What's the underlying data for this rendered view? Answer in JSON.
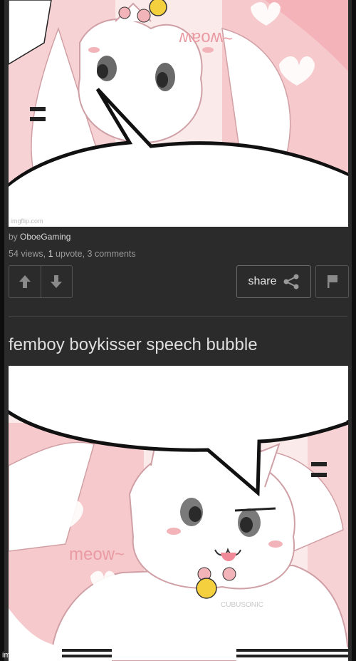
{
  "post1": {
    "image_watermark": "imgflip.com",
    "meow_text": "~woaw",
    "by_prefix": "by",
    "author": "OboeGaming",
    "views": "54",
    "views_label": "views,",
    "upvotes": "1",
    "upvote_label": "upvote,",
    "comments": "3 comments",
    "share_label": "share"
  },
  "post2": {
    "title": "femboy boykisser speech bubble",
    "meow_text": "meow~",
    "artist_signature": "CUBUSONIC",
    "watermark": "imgflip.com"
  },
  "colors": {
    "background": "#2b2b2b",
    "text_muted": "#9a9a9a",
    "text_light": "#dedede",
    "art_pink": "#f2b4b9",
    "art_bg": "#fbeaea"
  },
  "icons": {
    "upvote": "arrow-up-icon",
    "downvote": "arrow-down-icon",
    "share": "share-icon",
    "flag": "flag-icon"
  }
}
